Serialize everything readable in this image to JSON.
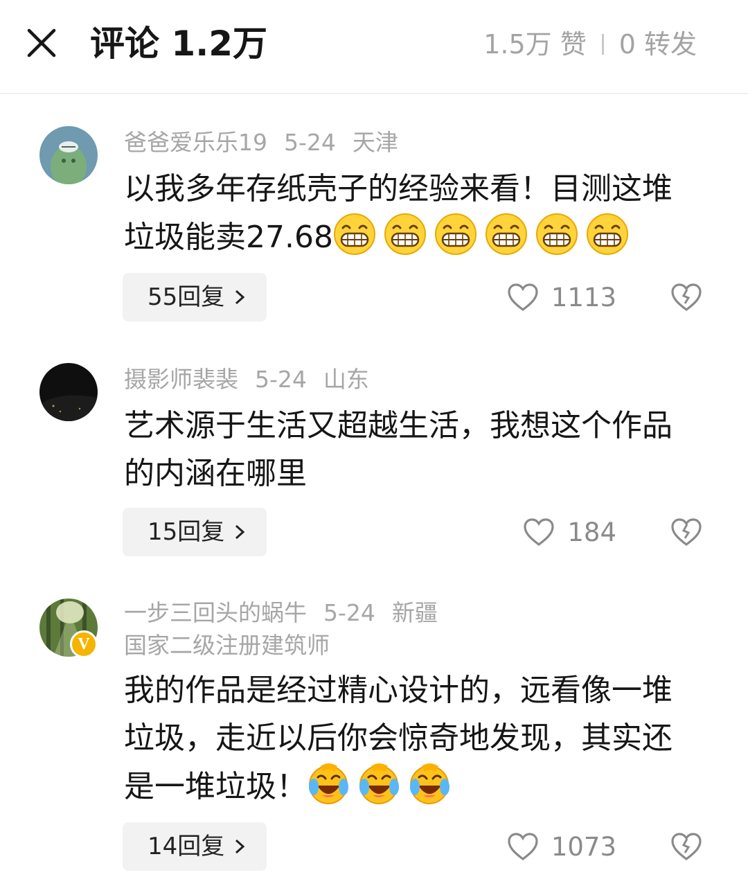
{
  "header": {
    "title": "评论 1.2万",
    "likes": "1.5万 赞",
    "shares": "0 转发"
  },
  "comments": [
    {
      "username": "爸爸爱乐乐19",
      "date": "5-24",
      "location": "天津",
      "text": "以我多年存纸壳子的经验来看！目测这堆垃圾能卖27.68",
      "emoji": "grinning-emoji",
      "emoji_count": 6,
      "replies": "55回复",
      "likes": "1113"
    },
    {
      "username": "摄影师裴裴",
      "date": "5-24",
      "location": "山东",
      "text": "艺术源于生活又超越生活，我想这个作品的内涵在哪里",
      "replies": "15回复",
      "likes": "184"
    },
    {
      "username": "一步三回头的蜗牛",
      "date": "5-24",
      "location": "新疆",
      "subtitle": "国家二级注册建筑师",
      "text": "我的作品是经过精心设计的，远看像一堆垃圾，走近以后你会惊奇地发现，其实还是一堆垃圾！",
      "emoji": "laughing-crying-emoji",
      "emoji_count": 3,
      "replies": "14回复",
      "likes": "1073",
      "verified_badge": "V"
    }
  ],
  "colors": {
    "text_primary": "#161616",
    "text_secondary": "#a6a6a6",
    "reply_bg": "#f2f2f2",
    "verified": "#f5b400"
  }
}
